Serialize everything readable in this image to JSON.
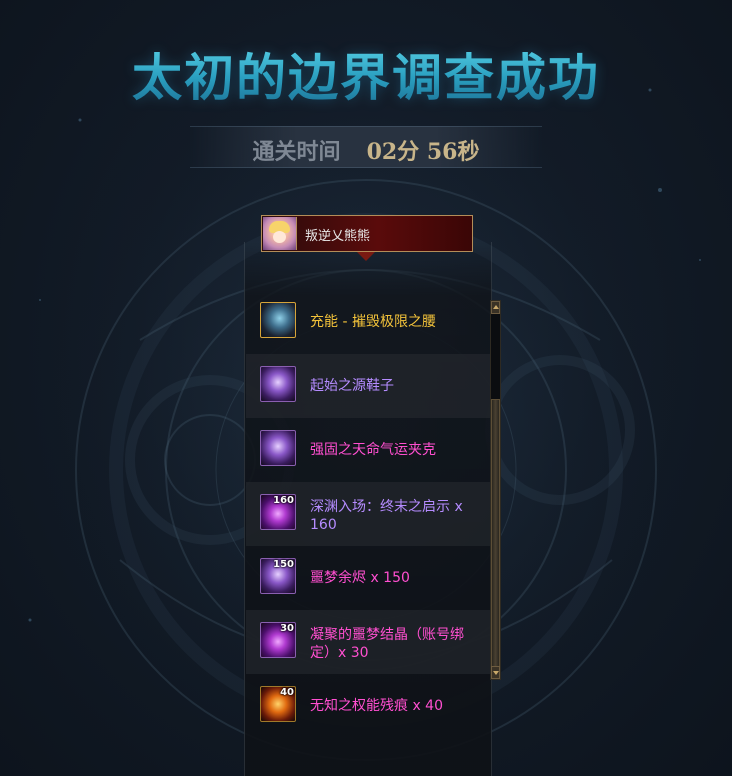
{
  "screen": {
    "title": "太初的边界调查成功",
    "clear_time_label": "通关时间",
    "clear_time_value": "02分 56秒"
  },
  "player": {
    "name": "叛逆乂熊熊",
    "avatar": "character-portrait"
  },
  "colors": {
    "title": "#3fb8d0",
    "time_value": "#c8b58a",
    "rarity_epic": "#f2c23a",
    "rarity_unique": "#b58cff",
    "rarity_rare": "#ff4fd0"
  },
  "rewards": [
    {
      "name": "充能 - 摧毁极限之腰",
      "rarity": "epic",
      "icon": "belt-icon",
      "count_badge": ""
    },
    {
      "name": "起始之源鞋子",
      "rarity": "unique",
      "icon": "shoes-icon",
      "count_badge": ""
    },
    {
      "name": "强固之天命气运夹克",
      "rarity": "rare",
      "icon": "jacket-icon",
      "count_badge": ""
    },
    {
      "name": "深渊入场：终末之启示 x 160",
      "rarity": "unique",
      "icon": "abyss-ticket-icon",
      "count_badge": "160"
    },
    {
      "name": "噩梦余烬 x 150",
      "rarity": "rare",
      "icon": "ember-icon",
      "count_badge": "150"
    },
    {
      "name": "凝聚的噩梦结晶（账号绑定）x 30",
      "rarity": "rare",
      "icon": "crystal-icon",
      "count_badge": "30"
    },
    {
      "name": "无知之权能残痕 x 40",
      "rarity": "rare",
      "icon": "trace-icon",
      "count_badge": "40"
    }
  ],
  "scrollbar": {
    "scroll_position_fraction": 0.0
  }
}
